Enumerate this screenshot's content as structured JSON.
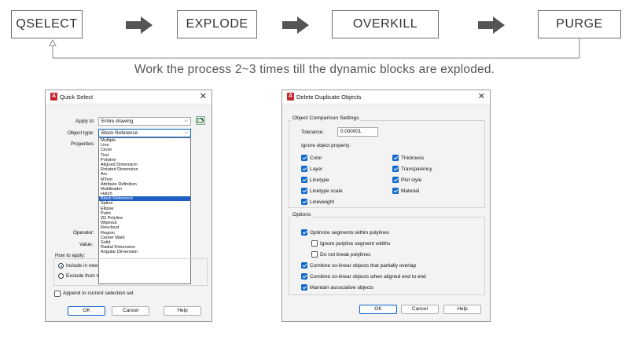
{
  "flow": {
    "steps": [
      "QSELECT",
      "EXPLODE",
      "OVERKILL",
      "PURGE"
    ],
    "caption": "Work the process 2~3 times till the dynamic blocks are exploded."
  },
  "quick_select": {
    "title": "Quick Select",
    "apply_to_label": "Apply to:",
    "apply_to_value": "Entire drawing",
    "object_type_label": "Object type:",
    "object_type_value": "Block Reference",
    "properties_label": "Properties:",
    "operator_label": "Operator:",
    "value_label": "Value:",
    "how_to_apply_label": "How to apply:",
    "include_label": "Include in new",
    "exclude_label": "Exclude from n",
    "append_label": "Append to current selection set",
    "ok": "OK",
    "cancel": "Cancel",
    "help": "Help",
    "object_types": [
      "Multiple",
      "Line",
      "Circle",
      "Text",
      "Polyline",
      "Aligned Dimension",
      "Rotated Dimension",
      "Arc",
      "MText",
      "Attribute Definition",
      "Multileader",
      "Hatch",
      "Block Reference",
      "Spline",
      "Ellipse",
      "Point",
      "2D Polyline",
      "Wipeout",
      "Revcloud",
      "Region",
      "Center Mark",
      "Solid",
      "Radial Dimension",
      "Angular Dimension"
    ],
    "selected_type": "Block Reference"
  },
  "delete_duplicates": {
    "title": "Delete Duplicate Objects",
    "settings_group": "Object Comparison Settings",
    "tolerance_label": "Tolerance:",
    "tolerance_value": "0.000001",
    "ignore_label": "Ignore object property:",
    "props_left": [
      "Color",
      "Layer",
      "Linetype",
      "Linetype scale",
      "Lineweight"
    ],
    "props_right": [
      "Thickness",
      "Transparency",
      "Plot style",
      "Material"
    ],
    "options_group": "Options",
    "opt_optimize": "Optimize segments within polylines",
    "opt_ignore_widths": "Ignore polyline segment widths",
    "opt_no_break": "Do not break polylines",
    "opt_combine_partial": "Combine co-linear objects that partially overlap",
    "opt_combine_end": "Combine co-linear objects when aligned end to end",
    "opt_assoc": "Maintain associative objects",
    "ok": "OK",
    "cancel": "Cancel",
    "help": "Help"
  },
  "colors": {
    "accent": "#1168cc",
    "selection": "#1e5fc4",
    "app_icon": "#c4262e",
    "arrow": "#555555"
  }
}
